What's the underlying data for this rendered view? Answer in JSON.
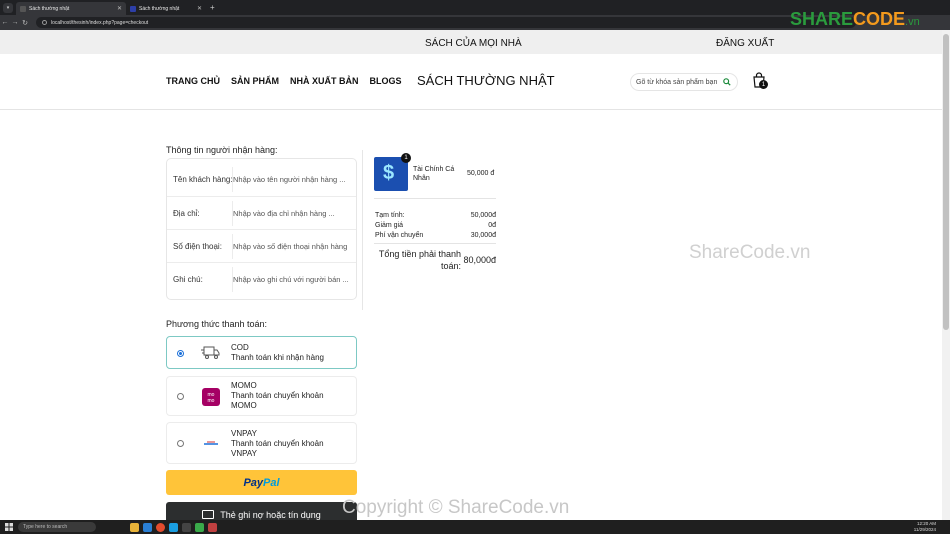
{
  "browser": {
    "tabs": [
      {
        "title": "Sách thường nhật",
        "active": true
      },
      {
        "title": "Sách thường nhật",
        "active": false
      }
    ],
    "url": "localhost/thesinh/index.php?page=checkout"
  },
  "site": {
    "slogan": "SÁCH CỦA MỌI NHÀ",
    "logout": "ĐĂNG XUẤT",
    "menu": [
      "TRANG CHỦ",
      "SẢN PHẨM",
      "NHÀ XUẤT BẢN",
      "BLOGS"
    ],
    "brand": "SÁCH THƯỜNG NHẬT",
    "search_placeholder": "Gõ từ khóa sản phẩm bạn",
    "cart_count": "1"
  },
  "checkout": {
    "receiver_title": "Thông tin người nhận hàng:",
    "fields": [
      {
        "label": "Tên khách hàng:",
        "placeholder": "Nhập vào tên người nhận hàng ..."
      },
      {
        "label": "Địa chỉ:",
        "placeholder": "Nhập vào địa chỉ nhận hàng ..."
      },
      {
        "label": "Số điện thoại:",
        "placeholder": "Nhập vào số điện thoại nhận hàng"
      },
      {
        "label": "Ghi chú:",
        "placeholder": "Nhập vào ghi chú với người bán ..."
      }
    ],
    "payment_title": "Phương thức thanh toán:",
    "methods": [
      {
        "name": "COD",
        "desc1": "Thanh toán khi nhận hàng",
        "desc2": "",
        "selected": true,
        "icon": "delivery-truck-icon"
      },
      {
        "name": "MOMO",
        "desc1": "Thanh toán chuyển khoản",
        "desc2": "MOMO",
        "selected": false,
        "icon": "momo-logo-icon"
      },
      {
        "name": "VNPAY",
        "desc1": "Thanh toán chuyển khoản",
        "desc2": "VNPAY",
        "selected": false,
        "icon": "vnpay-logo-icon"
      }
    ],
    "paypal_a": "Pay",
    "paypal_b": "Pal",
    "card_button": "Thẻ ghi nợ hoặc tín dụng"
  },
  "order": {
    "item": {
      "name": "Tài Chính Cá Nhân",
      "price": "50,000 đ",
      "qty": "1"
    },
    "subtotal_label": "Tạm tính:",
    "subtotal": "50,000đ",
    "discount_label": "Giảm giá",
    "discount": "0đ",
    "shipping_label": "Phí vận chuyển",
    "shipping": "30,000đ",
    "total_label": "Tổng tiền phải thanh toán:",
    "total": "80,000đ"
  },
  "watermarks": {
    "logo_a": "SHARE",
    "logo_b": "CODE",
    "logo_c": ".vn",
    "mid": "ShareCode.vn",
    "bottom": "Copyright © ShareCode.vn"
  },
  "taskbar": {
    "search": "Type here to search",
    "time": "12:20 AM",
    "date": "11/29/2024"
  },
  "colors": {
    "accent_blue": "#1a6fd8",
    "selected_border": "#7dc9c4",
    "paypal_yellow": "#ffc439"
  }
}
